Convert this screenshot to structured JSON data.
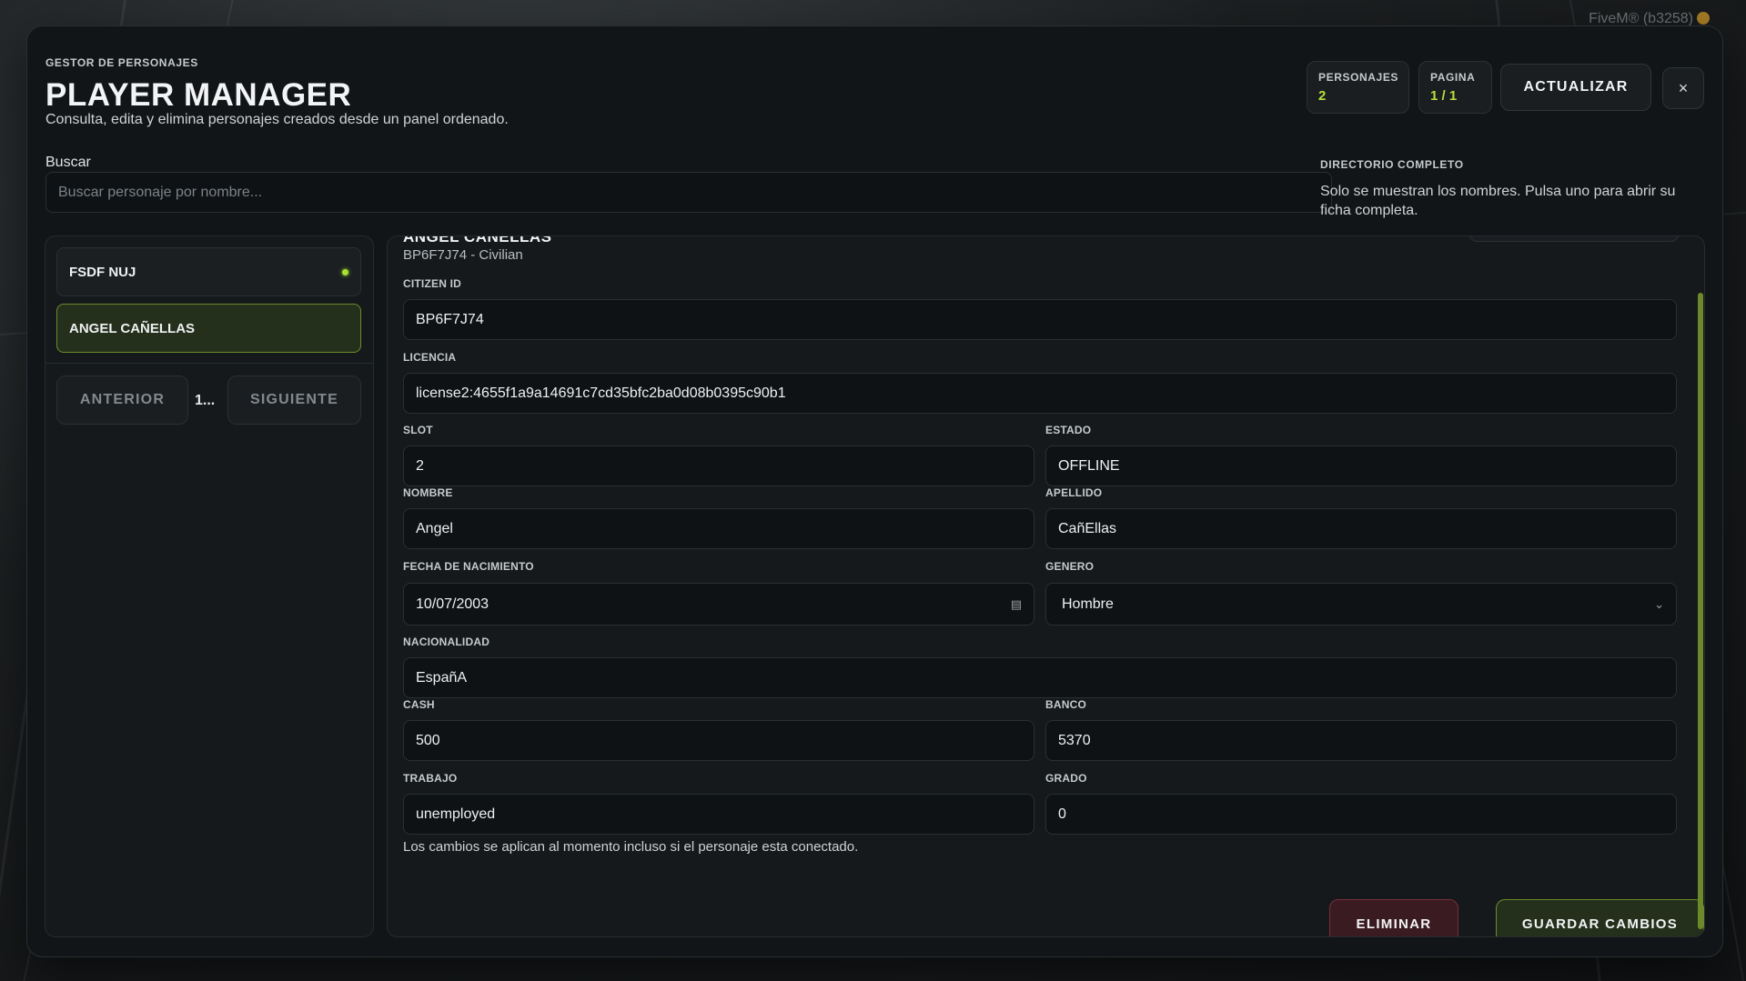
{
  "brand": {
    "text": "FiveM® (b3258)"
  },
  "header": {
    "eyebrow": "GESTOR DE PERSONAJES",
    "title": "PLAYER MANAGER",
    "subtitle": "Consulta, edita y elimina personajes creados desde un panel ordenado."
  },
  "stats": {
    "characters": {
      "label": "PERSONAJES",
      "value": "2"
    },
    "page": {
      "label": "PAGINA",
      "value": "1 / 1"
    }
  },
  "toolbar": {
    "refresh_label": "ACTUALIZAR",
    "close_label": "×"
  },
  "search": {
    "label": "Buscar",
    "placeholder": "Buscar personaje por nombre..."
  },
  "directory": {
    "title": "DIRECTORIO COMPLETO",
    "text": "Solo se muestran los nombres. Pulsa uno para abrir su ficha completa."
  },
  "sidebar": {
    "characters": [
      {
        "name": "FSDF NUJ",
        "online": true
      },
      {
        "name": "ANGEL CAÑELLAS",
        "online": false,
        "selected": true
      }
    ],
    "prev_label": "ANTERIOR",
    "page_indicator": "1...",
    "next_label": "SIGUIENTE"
  },
  "detail": {
    "name": "ANGEL CAÑELLAS",
    "meta": "BP6F7J74 - Civilian",
    "fields": {
      "citizen_id": {
        "label": "CITIZEN ID",
        "value": "BP6F7J74"
      },
      "license": {
        "label": "LICENCIA",
        "value": "license2:4655f1a9a14691c7cd35bfc2ba0d08b0395c90b1"
      },
      "slot": {
        "label": "SLOT",
        "value": "2"
      },
      "estado": {
        "label": "ESTADO",
        "value": "OFFLINE"
      },
      "nombre": {
        "label": "NOMBRE",
        "value": "Angel"
      },
      "apellido": {
        "label": "APELLIDO",
        "value": "CañEllas"
      },
      "birthdate": {
        "label": "FECHA DE NACIMIENTO",
        "value": "10/07/2003"
      },
      "genero": {
        "label": "GENERO",
        "value": "Hombre"
      },
      "nacionalidad": {
        "label": "NACIONALIDAD",
        "value": "EspañA"
      },
      "cash": {
        "label": "CASH",
        "value": "500"
      },
      "banco": {
        "label": "BANCO",
        "value": "5370"
      },
      "trabajo": {
        "label": "TRABAJO",
        "value": "unemployed"
      },
      "grado": {
        "label": "GRADO",
        "value": "0"
      }
    },
    "note": "Los cambios se aplican al momento incluso si el personaje esta conectado.",
    "delete_label": "ELIMINAR",
    "save_label": "GUARDAR CAMBIOS"
  },
  "icons": {
    "online": "status-dot",
    "calendar": "calendar-icon",
    "select": "chevron-down-icon",
    "close": "close-icon"
  },
  "colors": {
    "accent": "#a6e22e",
    "accent_border": "#6d8a2a",
    "danger_border": "#7a2e3b",
    "panel_bg": "#121517"
  }
}
